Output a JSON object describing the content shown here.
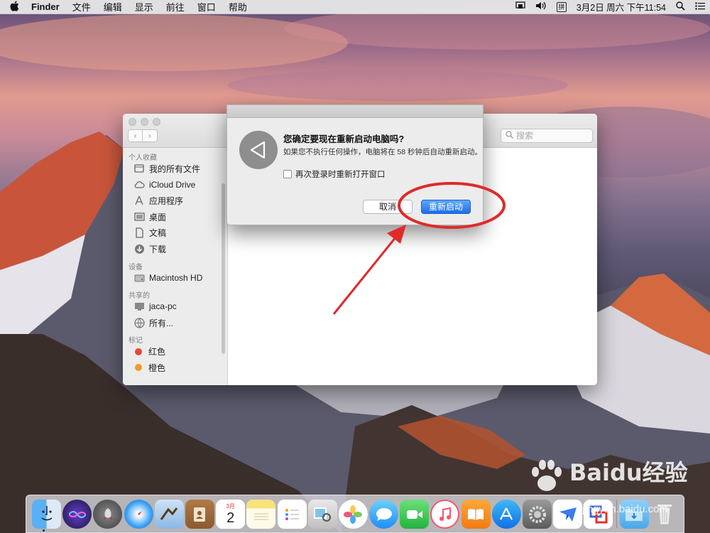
{
  "menubar": {
    "apple_icon": "apple-icon",
    "app_name": "Finder",
    "menus": [
      "文件",
      "编辑",
      "显示",
      "前往",
      "窗口",
      "帮助"
    ],
    "ime_badge": "拼",
    "datetime": "3月2日 周六 下午11:54"
  },
  "finder": {
    "search_placeholder": "搜索",
    "sections": {
      "favorites": "个人收藏",
      "devices": "设备",
      "shared": "共享的",
      "tags": "标记"
    },
    "favorites": [
      {
        "label": "我的所有文件",
        "icon": "all-files-icon"
      },
      {
        "label": "iCloud Drive",
        "icon": "cloud-icon"
      },
      {
        "label": "应用程序",
        "icon": "applications-icon"
      },
      {
        "label": "桌面",
        "icon": "desktop-icon"
      },
      {
        "label": "文稿",
        "icon": "documents-icon"
      },
      {
        "label": "下载",
        "icon": "downloads-icon"
      }
    ],
    "devices": [
      {
        "label": "Macintosh HD",
        "icon": "disk-icon"
      }
    ],
    "shared": [
      {
        "label": "jaca-pc",
        "icon": "computer-icon"
      },
      {
        "label": "所有...",
        "icon": "network-icon"
      }
    ],
    "tags": [
      {
        "label": "红色",
        "color": "#e8453c"
      },
      {
        "label": "橙色",
        "color": "#f39a26"
      }
    ]
  },
  "dialog": {
    "title": "您确定要现在重新启动电脑吗?",
    "message": "如果您不执行任何操作，电脑将在 58 秒钟后自动重新启动。",
    "checkbox_label": "再次登录时重新打开窗口",
    "checkbox_checked": false,
    "cancel_label": "取消",
    "restart_label": "重新启动",
    "accent_color": "#1b6fe8"
  },
  "annotation": {
    "color": "#e02a2a"
  },
  "dock": {
    "icons": [
      "finder-icon",
      "siri-icon",
      "launchpad-icon",
      "safari-icon",
      "mail-icon",
      "contacts-icon",
      "calendar-icon",
      "notes-icon",
      "reminders-icon",
      "preview-icon",
      "photos-icon",
      "messages-icon",
      "facetime-icon",
      "music-icon",
      "books-icon",
      "app-store-icon",
      "system-preferences-icon",
      "feishu-icon",
      "parallels-icon",
      "downloads-folder-icon",
      "trash-icon"
    ],
    "calendar_month": "3月",
    "calendar_day": "2"
  },
  "watermark": {
    "brand": "Baidu经验",
    "url": "jingyan.baidu.com"
  }
}
